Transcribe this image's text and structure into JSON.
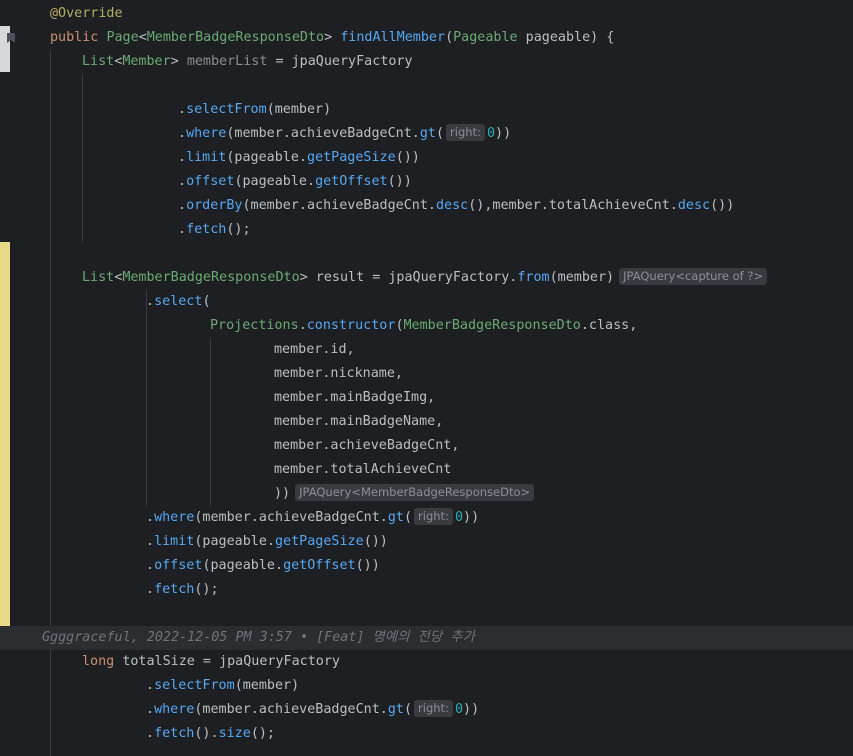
{
  "editor": {
    "lines": [
      {
        "id": "l1",
        "indent": 0,
        "tokens": [
          {
            "t": "@Override",
            "c": "ann"
          }
        ]
      },
      {
        "id": "l2",
        "indent": 0,
        "tokens": [
          {
            "t": "public ",
            "c": "kw"
          },
          {
            "t": "Page",
            "c": "cls"
          },
          {
            "t": "<"
          },
          {
            "t": "MemberBadgeResponseDto",
            "c": "cls"
          },
          {
            "t": "> "
          },
          {
            "t": "findAllMember",
            "c": "mth"
          },
          {
            "t": "("
          },
          {
            "t": "Pageable",
            "c": "cls"
          },
          {
            "t": " pageable) {"
          }
        ]
      },
      {
        "id": "l3",
        "indent": 4,
        "tokens": [
          {
            "t": "List",
            "c": "cls"
          },
          {
            "t": "<"
          },
          {
            "t": "Member",
            "c": "cls"
          },
          {
            "t": "> "
          },
          {
            "t": "memberList",
            "c": "dim"
          },
          {
            "t": " = jpaQueryFactory"
          }
        ]
      },
      {
        "id": "l4",
        "indent": 0,
        "tokens": []
      },
      {
        "id": "l5",
        "indent": 16,
        "tokens": [
          {
            "t": "."
          },
          {
            "t": "selectFrom",
            "c": "mth"
          },
          {
            "t": "(member)"
          }
        ]
      },
      {
        "id": "l6",
        "indent": 16,
        "tokens": [
          {
            "t": "."
          },
          {
            "t": "where",
            "c": "mth"
          },
          {
            "t": "(member.achieveBadgeCnt."
          },
          {
            "t": "gt",
            "c": "mth"
          },
          {
            "t": "("
          },
          {
            "hint": "right:"
          },
          {
            "t": "0",
            "c": "num"
          },
          {
            "t": "))"
          }
        ]
      },
      {
        "id": "l7",
        "indent": 16,
        "tokens": [
          {
            "t": "."
          },
          {
            "t": "limit",
            "c": "mth"
          },
          {
            "t": "(pageable."
          },
          {
            "t": "getPageSize",
            "c": "mth"
          },
          {
            "t": "())"
          }
        ]
      },
      {
        "id": "l8",
        "indent": 16,
        "tokens": [
          {
            "t": "."
          },
          {
            "t": "offset",
            "c": "mth"
          },
          {
            "t": "(pageable."
          },
          {
            "t": "getOffset",
            "c": "mth"
          },
          {
            "t": "())"
          }
        ]
      },
      {
        "id": "l9",
        "indent": 16,
        "tokens": [
          {
            "t": "."
          },
          {
            "t": "orderBy",
            "c": "mth"
          },
          {
            "t": "(member.achieveBadgeCnt."
          },
          {
            "t": "desc",
            "c": "mth"
          },
          {
            "t": "(),member.totalAchieveCnt."
          },
          {
            "t": "desc",
            "c": "mth"
          },
          {
            "t": "())"
          }
        ]
      },
      {
        "id": "l10",
        "indent": 16,
        "tokens": [
          {
            "t": "."
          },
          {
            "t": "fetch",
            "c": "mth"
          },
          {
            "t": "();"
          }
        ]
      },
      {
        "id": "l11",
        "indent": 0,
        "tokens": []
      },
      {
        "id": "l12",
        "indent": 4,
        "tokens": [
          {
            "t": "List",
            "c": "cls"
          },
          {
            "t": "<"
          },
          {
            "t": "MemberBadgeResponseDto",
            "c": "cls"
          },
          {
            "t": "> result = jpaQueryFactory."
          },
          {
            "t": "from",
            "c": "mth"
          },
          {
            "t": "(member)"
          },
          {
            "trail": "JPAQuery<capture of ?>"
          }
        ]
      },
      {
        "id": "l13",
        "indent": 12,
        "tokens": [
          {
            "t": "."
          },
          {
            "t": "select",
            "c": "mth"
          },
          {
            "t": "("
          }
        ]
      },
      {
        "id": "l14",
        "indent": 20,
        "tokens": [
          {
            "t": "Projections",
            "c": "cls"
          },
          {
            "t": "."
          },
          {
            "t": "constructor",
            "c": "mth"
          },
          {
            "t": "("
          },
          {
            "t": "MemberBadgeResponseDto",
            "c": "cls"
          },
          {
            "t": ".class,"
          }
        ]
      },
      {
        "id": "l15",
        "indent": 28,
        "tokens": [
          {
            "t": "member.id,"
          }
        ]
      },
      {
        "id": "l16",
        "indent": 28,
        "tokens": [
          {
            "t": "member.nickname,"
          }
        ]
      },
      {
        "id": "l17",
        "indent": 28,
        "tokens": [
          {
            "t": "member.mainBadgeImg,"
          }
        ]
      },
      {
        "id": "l18",
        "indent": 28,
        "tokens": [
          {
            "t": "member.mainBadgeName,"
          }
        ]
      },
      {
        "id": "l19",
        "indent": 28,
        "tokens": [
          {
            "t": "member.achieveBadgeCnt,"
          }
        ]
      },
      {
        "id": "l20",
        "indent": 28,
        "tokens": [
          {
            "t": "member.totalAchieveCnt"
          }
        ]
      },
      {
        "id": "l21",
        "indent": 28,
        "tokens": [
          {
            "t": "))"
          },
          {
            "trail": "JPAQuery<MemberBadgeResponseDto>"
          }
        ]
      },
      {
        "id": "l22",
        "indent": 12,
        "tokens": [
          {
            "t": "."
          },
          {
            "t": "where",
            "c": "mth"
          },
          {
            "t": "(member.achieveBadgeCnt."
          },
          {
            "t": "gt",
            "c": "mth"
          },
          {
            "t": "("
          },
          {
            "hint": "right:"
          },
          {
            "t": "0",
            "c": "num"
          },
          {
            "t": "))"
          }
        ]
      },
      {
        "id": "l23",
        "indent": 12,
        "tokens": [
          {
            "t": "."
          },
          {
            "t": "limit",
            "c": "mth"
          },
          {
            "t": "(pageable."
          },
          {
            "t": "getPageSize",
            "c": "mth"
          },
          {
            "t": "())"
          }
        ]
      },
      {
        "id": "l24",
        "indent": 12,
        "tokens": [
          {
            "t": "."
          },
          {
            "t": "offset",
            "c": "mth"
          },
          {
            "t": "(pageable."
          },
          {
            "t": "getOffset",
            "c": "mth"
          },
          {
            "t": "())"
          }
        ]
      },
      {
        "id": "l25",
        "indent": 12,
        "tokens": [
          {
            "t": "."
          },
          {
            "t": "fetch",
            "c": "mth"
          },
          {
            "t": "();"
          }
        ]
      },
      {
        "id": "l26",
        "indent": 0,
        "tokens": []
      },
      {
        "id": "l27",
        "indent": 4,
        "tokens": [
          {
            "t": "long ",
            "c": "kw"
          },
          {
            "t": "totalSize = jpaQueryFactory"
          }
        ]
      },
      {
        "id": "l28",
        "indent": 12,
        "tokens": [
          {
            "t": "."
          },
          {
            "t": "selectFrom",
            "c": "mth"
          },
          {
            "t": "(member)"
          }
        ]
      },
      {
        "id": "l29",
        "indent": 12,
        "tokens": [
          {
            "t": "."
          },
          {
            "t": "where",
            "c": "mth"
          },
          {
            "t": "(member.achieveBadgeCnt."
          },
          {
            "t": "gt",
            "c": "mth"
          },
          {
            "t": "("
          },
          {
            "hint": "right:"
          },
          {
            "t": "0",
            "c": "num"
          },
          {
            "t": "))"
          }
        ]
      },
      {
        "id": "l30",
        "indent": 12,
        "tokens": [
          {
            "t": "."
          },
          {
            "t": "fetch",
            "c": "mth"
          },
          {
            "t": "()."
          },
          {
            "t": "size",
            "c": "mth"
          },
          {
            "t": "();"
          }
        ]
      }
    ],
    "blame": "Ggggraceful, 2022-12-05 PM 3:57 • [Feat] 명예의 전당 추가",
    "colors": {
      "background": "#1e1f22",
      "keyword": "#cf8e6d",
      "annotation": "#b3ae60",
      "class": "#6aab73",
      "method": "#56a8f5",
      "number": "#2aacb8",
      "gutter_change": "#e8d98a",
      "blame_bg": "#2b2d30"
    },
    "icons": {
      "gutter": "bookmark-icon"
    }
  }
}
